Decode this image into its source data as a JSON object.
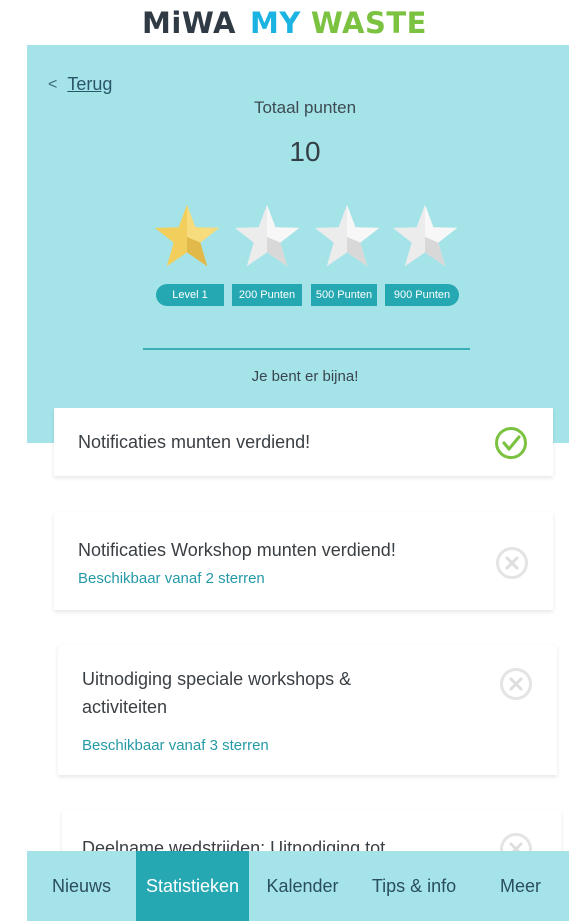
{
  "logo": {
    "part1": "MiWA",
    "part2": "MY",
    "part3": "WASTE"
  },
  "header": {
    "back_label": "Terug"
  },
  "score": {
    "label": "Totaal punten",
    "value": "10",
    "stars_earned": 1,
    "stars_total": 4
  },
  "levels": [
    "Level 1",
    "200 Punten",
    "500 Punten",
    "900 Punten"
  ],
  "progress_message": "Je bent er bijna!",
  "rewards": [
    {
      "title": "Notificaties munten verdiend!",
      "subtitle": "",
      "status": "earned"
    },
    {
      "title": "Notificaties Workshop munten verdiend!",
      "subtitle": "Beschikbaar vanaf 2 sterren",
      "status": "locked"
    },
    {
      "title": "Uitnodiging speciale workshops & activiteiten",
      "subtitle": "Beschikbaar vanaf 3 sterren",
      "status": "locked"
    },
    {
      "title": "Deelname wedstrijden: Uitnodiging tot",
      "subtitle": "",
      "status": "locked"
    }
  ],
  "tabs": [
    {
      "label": "Nieuws",
      "active": false
    },
    {
      "label": "Statistieken",
      "active": true
    },
    {
      "label": "Kalender",
      "active": false
    },
    {
      "label": "Tips & info",
      "active": false
    },
    {
      "label": "Meer",
      "active": false
    }
  ],
  "colors": {
    "accent": "#26a8b3",
    "hero_bg": "#a4e4e9",
    "star_active": "#f2cf5c",
    "star_inactive": "#ececec",
    "check_green": "#7cc241"
  }
}
